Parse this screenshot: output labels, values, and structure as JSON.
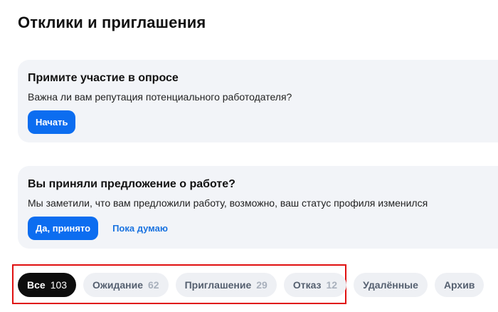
{
  "page": {
    "title": "Отклики и приглашения"
  },
  "survey_card": {
    "title": "Примите участие в опросе",
    "text": "Важна ли вам репутация потенциального работодателя?",
    "start_label": "Начать"
  },
  "offer_card": {
    "title": "Вы приняли предложение о работе?",
    "text": "Мы заметили, что вам предложили работу, возможно, ваш статус профиля изменился",
    "accept_label": "Да, принято",
    "think_label": "Пока думаю"
  },
  "filters": [
    {
      "label": "Все",
      "count": "103",
      "active": true
    },
    {
      "label": "Ожидание",
      "count": "62",
      "active": false
    },
    {
      "label": "Приглашение",
      "count": "29",
      "active": false
    },
    {
      "label": "Отказ",
      "count": "12",
      "active": false
    },
    {
      "label": "Удалённые",
      "count": "",
      "active": false
    },
    {
      "label": "Архив",
      "count": "",
      "active": false
    }
  ],
  "colors": {
    "primary": "#0c6df0",
    "highlight": "#e01010",
    "active_chip": "#0d0d0d"
  }
}
